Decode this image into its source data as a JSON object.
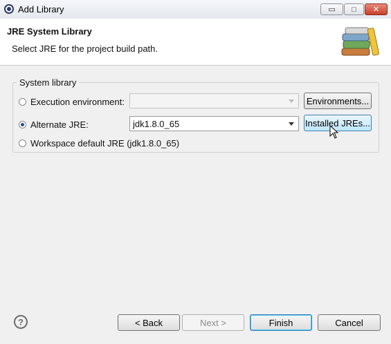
{
  "window": {
    "title": "Add Library",
    "minimize_glyph": "▭",
    "maximize_glyph": "□",
    "close_glyph": "✕"
  },
  "header": {
    "title": "JRE System Library",
    "description": "Select JRE for the project build path."
  },
  "group": {
    "label": "System library",
    "options": [
      {
        "label": "Execution environment:",
        "selected": false
      },
      {
        "label": "Alternate JRE:",
        "selected": true
      },
      {
        "label": "Workspace default JRE (jdk1.8.0_65)",
        "selected": false
      }
    ],
    "execution_env_value": "",
    "alternate_jre_value": "jdk1.8.0_65",
    "environments_button": "Environments...",
    "installed_jres_button": "Installed JREs..."
  },
  "footer": {
    "help_glyph": "?",
    "back": "< Back",
    "next": "Next >",
    "finish": "Finish",
    "cancel": "Cancel"
  }
}
